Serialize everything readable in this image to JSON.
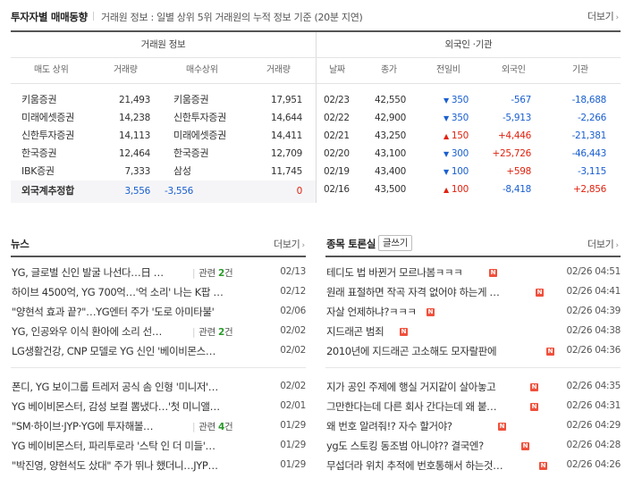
{
  "top": {
    "title": "투자자별 매매동향",
    "description": "거래원 정보 : 일별 상위 5위 거래원의 누적 정보 기준 (20분 지연)",
    "more": "더보기",
    "chevron": "›"
  },
  "broker": {
    "group_title": "거래원 정보",
    "headers": {
      "sell_top": "매도 상위",
      "sell_volume": "거래량",
      "buy_top": "매수상위",
      "buy_volume": "거래량"
    },
    "rows": [
      {
        "sell_name": "키움증권",
        "sell_vol": "21,493",
        "buy_name": "키움증권",
        "buy_vol": "17,951"
      },
      {
        "sell_name": "미래에셋증권",
        "sell_vol": "14,238",
        "buy_name": "신한투자증권",
        "buy_vol": "14,644"
      },
      {
        "sell_name": "신한투자증권",
        "sell_vol": "14,113",
        "buy_name": "미래에셋증권",
        "buy_vol": "14,411"
      },
      {
        "sell_name": "한국증권",
        "sell_vol": "12,464",
        "buy_name": "한국증권",
        "buy_vol": "12,709"
      },
      {
        "sell_name": "IBK증권",
        "sell_vol": "7,333",
        "buy_name": "삼성",
        "buy_vol": "11,745"
      }
    ],
    "foreign_estimate": {
      "label": "외국계추정합",
      "sell": "3,556",
      "net": "-3,556",
      "buy": "0"
    }
  },
  "investor": {
    "group_title": "외국인 ·기관",
    "headers": {
      "date": "날짜",
      "close": "종가",
      "change": "전일비",
      "foreign": "외국인",
      "institution": "기관"
    },
    "rows": [
      {
        "date": "02/23",
        "close": "42,550",
        "dir": "down",
        "change": "350",
        "foreign": "-567",
        "institution": "-18,688"
      },
      {
        "date": "02/22",
        "close": "42,900",
        "dir": "down",
        "change": "350",
        "foreign": "-5,913",
        "institution": "-2,266"
      },
      {
        "date": "02/21",
        "close": "43,250",
        "dir": "up",
        "change": "150",
        "foreign": "+4,446",
        "institution": "-21,381"
      },
      {
        "date": "02/20",
        "close": "43,100",
        "dir": "down",
        "change": "300",
        "foreign": "+25,726",
        "institution": "-46,443"
      },
      {
        "date": "02/19",
        "close": "43,400",
        "dir": "down",
        "change": "100",
        "foreign": "+598",
        "institution": "-3,115"
      },
      {
        "date": "02/16",
        "close": "43,500",
        "dir": "up",
        "change": "100",
        "foreign": "-8,418",
        "institution": "+2,856"
      }
    ],
    "arrows": {
      "up": "▲",
      "down": "▼"
    }
  },
  "news": {
    "title": "뉴스",
    "more": "더보기",
    "related_label": "관련",
    "related_unit": "건",
    "items": [
      {
        "title": "YG, 글로벌 신인 발굴 나선다…日 …",
        "related": "2",
        "date": "02/13"
      },
      {
        "title": "하이브 4500억, YG 700억…'억 소리' 나는 K팝 …",
        "date": "02/12"
      },
      {
        "title": "\"양현석 효과 끝?\"…YG엔터 주가 '도로 아미타불'",
        "date": "02/06"
      },
      {
        "title": "YG, 인공와우 이식 환아에 소리 선…",
        "related": "2",
        "date": "02/02"
      },
      {
        "title": "LG생활건강, CNP 모델로 YG 신인 '베이비몬스…",
        "date": "02/02"
      },
      {
        "title": "폰디, YG 보이그룹 트레저 공식 솜 인형 '미니저'…",
        "date": "02/02"
      },
      {
        "title": "YG 베이비몬스터, 감성 보컬 뽐냈다…'첫 미니앨…",
        "date": "02/01"
      },
      {
        "title": "\"SM·하이브·JYP·YG에 투자해볼…",
        "related": "4",
        "date": "01/29"
      },
      {
        "title": "YG 베이비몬스터, 파리투로라 '스탁 인 더 미들'…",
        "date": "01/29"
      },
      {
        "title": "\"박진영, 양현석도 샀대\" 주가 뛰나 했더니…JYP…",
        "date": "01/29"
      }
    ]
  },
  "discussion": {
    "title": "종목 토론실",
    "write": "글쓰기",
    "more": "더보기",
    "new_badge": "N",
    "items": [
      {
        "title": "테디도 법 바뀐거 모르나봄ㅋㅋㅋ",
        "date": "02/26 04:51"
      },
      {
        "title": "원래 표절하면 작곡 자격 없어야 하는게 …",
        "date": "02/26 04:41"
      },
      {
        "title": "자살 언제하냐?ㅋㅋㅋ",
        "date": "02/26 04:39"
      },
      {
        "title": "지드래곤 범죄",
        "date": "02/26 04:38"
      },
      {
        "title": "2010년에 지드래곤 고소해도 모자랄판에",
        "date": "02/26 04:36"
      },
      {
        "title": "지가 공인 주제에 행실 거지같이 살아놓고",
        "date": "02/26 04:35"
      },
      {
        "title": "그만한다는데 다른 회사 간다는데 왜 붙…",
        "date": "02/26 04:31"
      },
      {
        "title": "왜 번호 알려줘!? 자수 할거야?",
        "date": "02/26 04:29"
      },
      {
        "title": "yg도 스토킹 동조범 아니야?? 결국엔?",
        "date": "02/26 04:28"
      },
      {
        "title": "무섭더라 위치 추적에 번호통해서 하는것…",
        "date": "02/26 04:26"
      }
    ]
  },
  "colors": {
    "up": "#e0220f",
    "down": "#1a5fd0",
    "related_count": "#2a9b2a",
    "new_badge": "#f0503c"
  }
}
